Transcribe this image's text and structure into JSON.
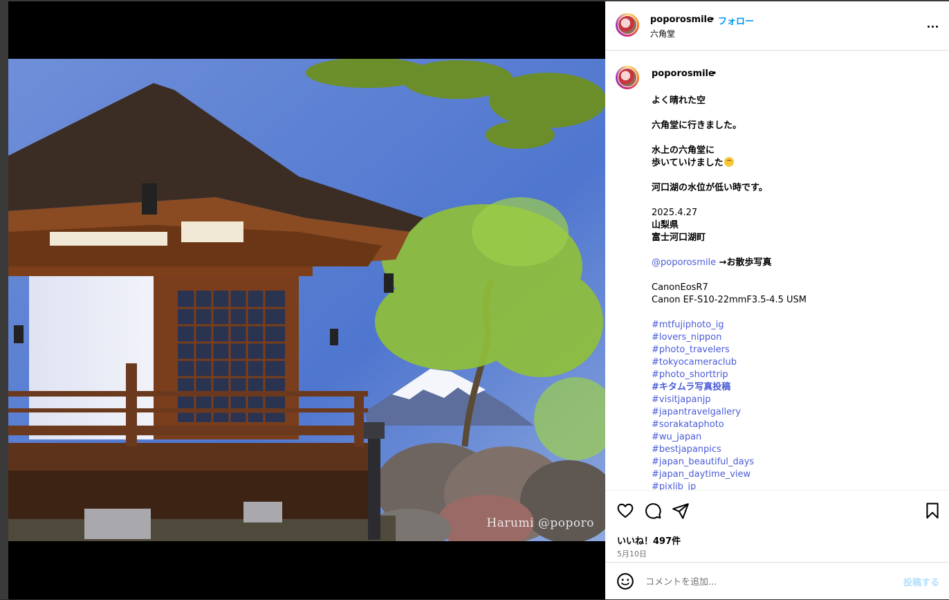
{
  "header": {
    "username": "poporosmile",
    "separator": "•",
    "follow_label": "フォロー",
    "location": "六角堂",
    "more_icon": "more-horizontal-icon"
  },
  "media": {
    "watermark": "Harumi   @poporo"
  },
  "caption": {
    "username": "poporosmile",
    "separator": "•",
    "lines": {
      "l1": "よく晴れた空",
      "l2": "六角堂に行きました。",
      "l3": "水上の六角堂に",
      "l4": "歩いていけました",
      "l5": "河口湖の水位が低い時です。",
      "l6": "2025.4.27",
      "l7": "山梨県",
      "l8": "富士河口湖町",
      "mention": "@poporosmile",
      "mention_suffix": " →お散歩写真",
      "l9": "CanonEosR7",
      "l10": "Canon EF-S10-22mmF3.5-4.5 USM"
    },
    "hashtags": [
      "#mtfujiphoto_ig",
      "#lovers_nippon",
      "#photo_travelers",
      "#tokyocameraclub",
      "#photo_shorttrip",
      "#キタムラ写真投稿",
      "#visitjapanjp",
      "#japantravelgallery",
      "#sorakataphoto",
      "#wu_japan",
      "#bestjapanpics",
      "#japan_beautiful_days",
      "#japan_daytime_view",
      "#pixlib_jp"
    ]
  },
  "actions": {
    "like_icon": "heart-icon",
    "comment_icon": "comment-icon",
    "share_icon": "send-icon",
    "save_icon": "bookmark-icon",
    "likes_text": "いいね！497件",
    "date_text": "5月10日"
  },
  "composer": {
    "emoji_icon": "smiley-icon",
    "placeholder": "コメントを追加...",
    "post_label": "投稿する"
  },
  "colors": {
    "link": "#4a5bd8",
    "follow": "#0095f6",
    "post_disabled": "#b2dffc"
  }
}
